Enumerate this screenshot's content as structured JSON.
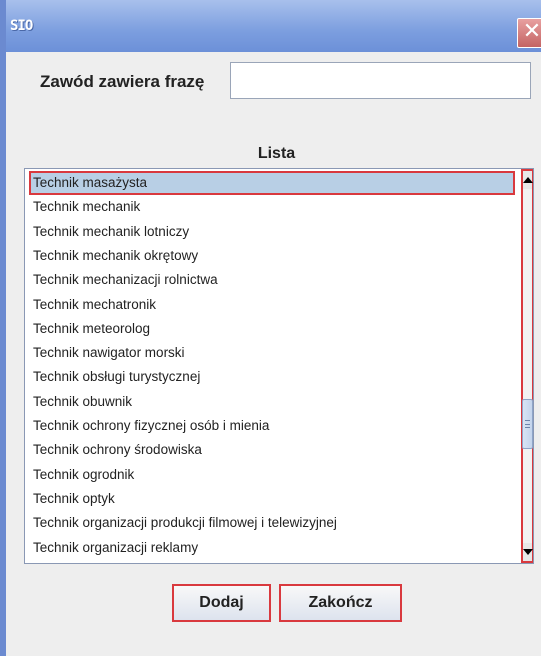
{
  "window": {
    "app_icon_text": "SIO",
    "close_glyph": "✕"
  },
  "search": {
    "label": "Zawód zawiera frazę",
    "value": "",
    "placeholder": ""
  },
  "list": {
    "header": "Lista",
    "selected_index": 0,
    "items": [
      "Technik masażysta",
      "Technik mechanik",
      "Technik mechanik lotniczy",
      "Technik mechanik okrętowy",
      "Technik mechanizacji rolnictwa",
      "Technik mechatronik",
      "Technik meteorolog",
      "Technik nawigator morski",
      "Technik obsługi turystycznej",
      "Technik obuwnik",
      "Technik ochrony fizycznej osób i mienia",
      "Technik ochrony środowiska",
      "Technik ogrodnik",
      "Technik optyk",
      "Technik organizacji produkcji filmowej i telewizyjnej",
      "Technik organizacji reklamy"
    ]
  },
  "buttons": {
    "add": "Dodaj",
    "exit": "Zakończ"
  }
}
